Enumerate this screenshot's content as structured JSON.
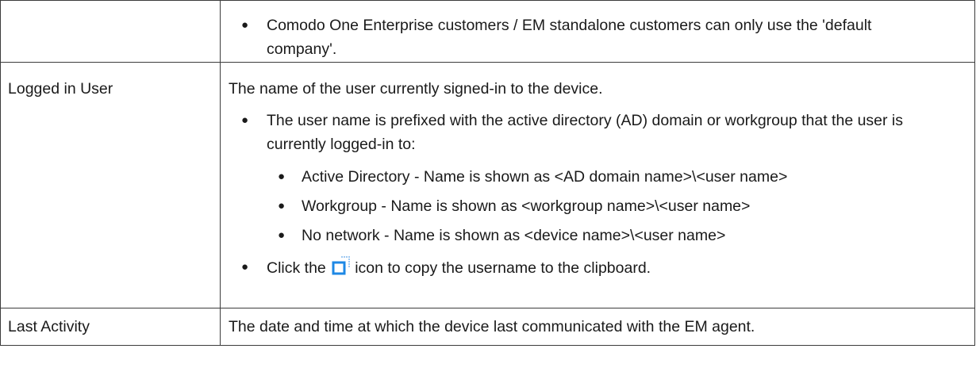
{
  "table": {
    "rows": [
      {
        "label": "",
        "bullets": [
          "Comodo One Enterprise customers / EM standalone customers can only use the 'default company'."
        ]
      },
      {
        "label": "Logged in User",
        "intro": "The name of the user currently signed-in to the device.",
        "bullet1": "The user name is prefixed with the active directory (AD) domain or workgroup that the user is currently logged-in to:",
        "sub_bullets": [
          "Active Directory - Name is shown as <AD domain name>\\<user name>",
          "Workgroup - Name is shown as <workgroup name>\\<user name>",
          "No network - Name is shown as <device name>\\<user name>"
        ],
        "bullet2_before": "Click the",
        "bullet2_icon": "copy-icon",
        "bullet2_after": "icon to copy the username to the clipboard."
      },
      {
        "label": "Last Activity",
        "description": "The date and time at which the device last communicated with the EM agent."
      }
    ]
  },
  "colors": {
    "border": "#3c3c3c",
    "text": "#1a1a1a",
    "icon_blue": "#1e88e5"
  }
}
